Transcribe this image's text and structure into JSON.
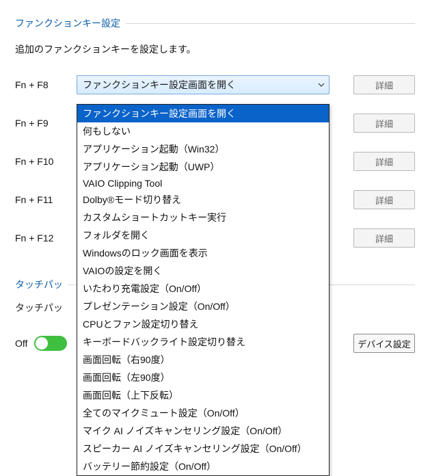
{
  "section": {
    "title": "ファンクションキー設定",
    "description": "追加のファンクションキーを設定します。"
  },
  "fn_rows": [
    {
      "label": "Fn + F8",
      "value": "ファンクションキー設定画面を開く",
      "detail": "詳細"
    },
    {
      "label": "Fn + F9",
      "value": "",
      "detail": "詳細"
    },
    {
      "label": "Fn + F10",
      "value": "",
      "detail": "詳細"
    },
    {
      "label": "Fn + F11",
      "value": "",
      "detail": "詳細"
    },
    {
      "label": "Fn + F12",
      "value": "",
      "detail": "詳細"
    }
  ],
  "dropdown": {
    "selected_index": 0,
    "options": [
      "ファンクションキー設定画面を開く",
      "何もしない",
      "アプリケーション起動（Win32）",
      "アプリケーション起動（UWP）",
      "VAIO Clipping Tool",
      "Dolby®モード切り替え",
      "カスタムショートカットキー実行",
      "フォルダを開く",
      "Windowsのロック画面を表示",
      "VAIOの設定を開く",
      "いたわり充電設定（On/Off）",
      "プレゼンテーション設定（On/Off）",
      "CPUとファン設定切り替え",
      "キーボードバックライト設定切り替え",
      "画面回転（右90度）",
      "画面回転（左90度）",
      "画面回転（上下反転）",
      "全てのマイクミュート設定（On/Off）",
      "マイク AI ノイズキャンセリング設定（On/Off）",
      "スピーカー AI ノイズキャンセリング設定（On/Off）",
      "バッテリー節約設定（On/Off）"
    ]
  },
  "touchpad": {
    "section_title_prefix": "タッチパッ",
    "label_prefix": "タッチパッ",
    "toggle_state_label": "Off",
    "device_settings_button": "デバイス設定"
  }
}
